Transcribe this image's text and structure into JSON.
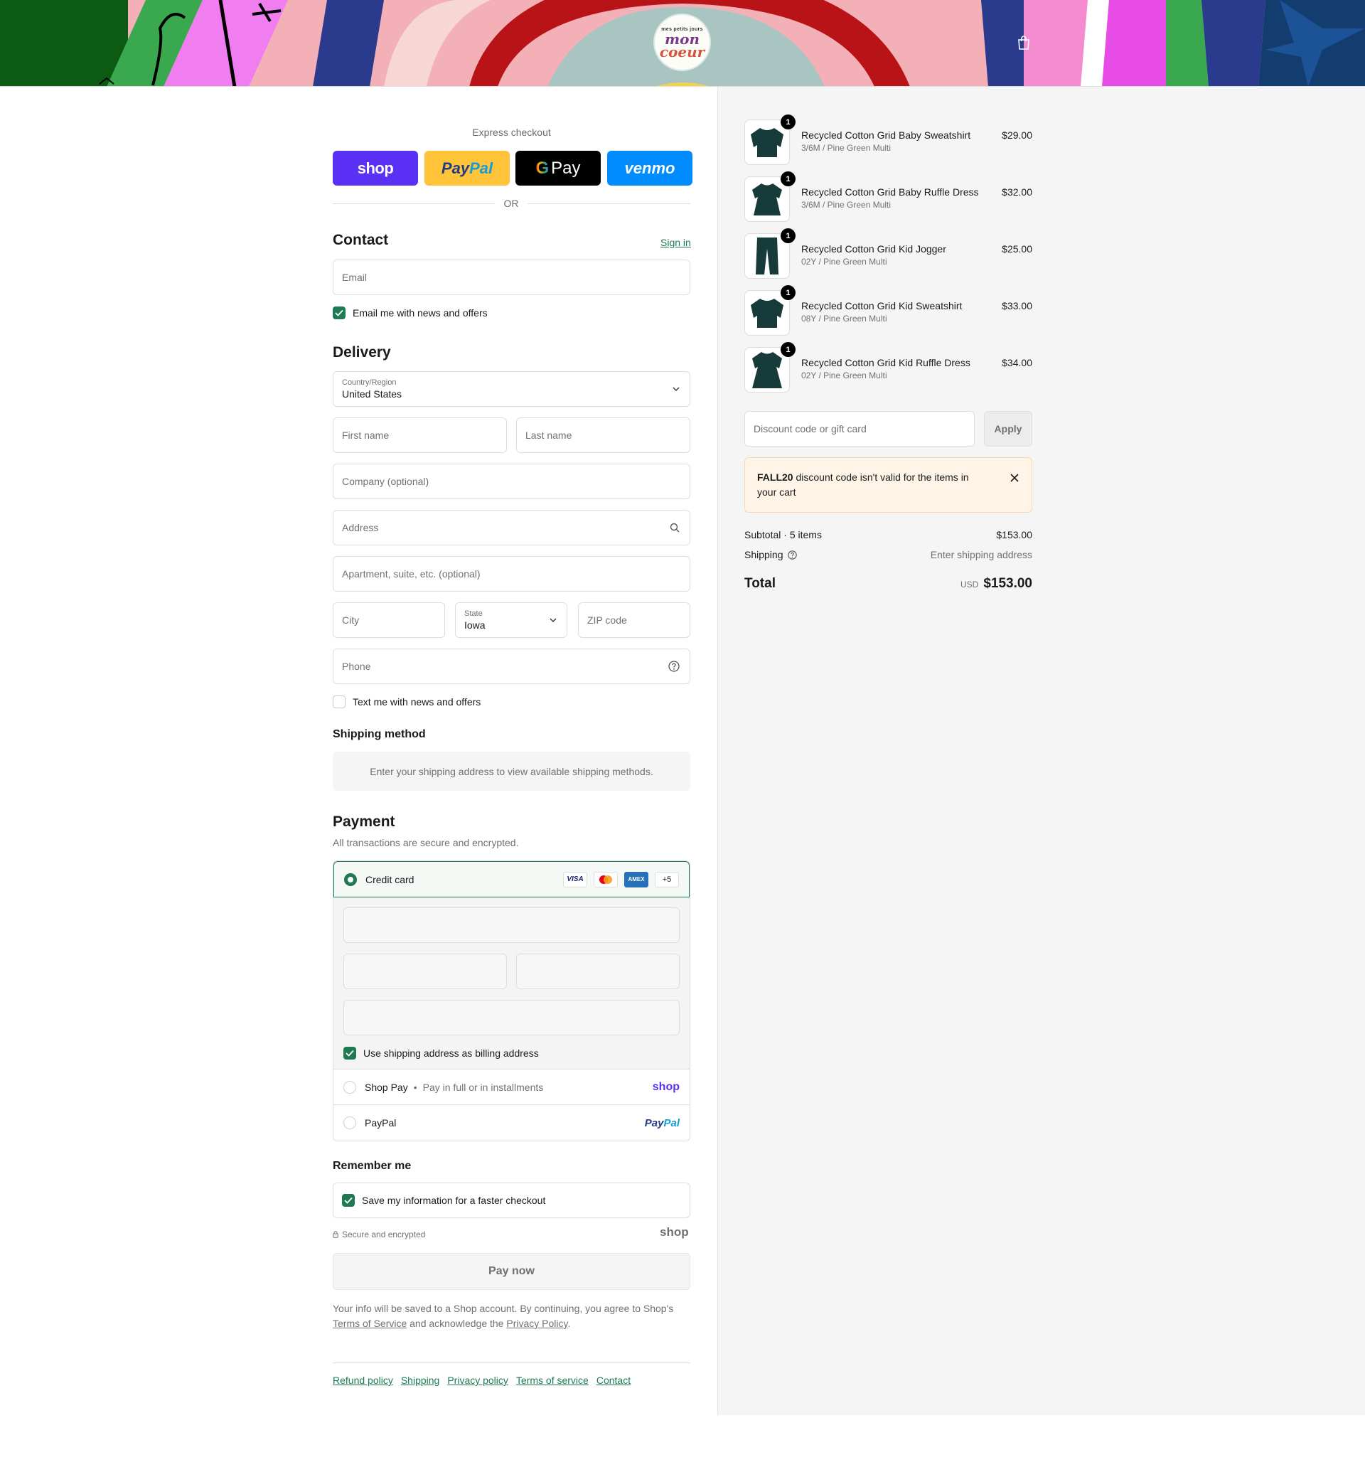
{
  "header": {
    "logo_small": "mes petits jours",
    "logo_line1": "mon",
    "logo_line2": "coeur"
  },
  "express": {
    "label": "Express checkout",
    "shop": "shop",
    "paypal_a": "Pay",
    "paypal_b": "Pal",
    "gpay_g": "G",
    "gpay_pay": "Pay",
    "venmo": "venmo",
    "or": "OR"
  },
  "contact": {
    "title": "Contact",
    "sign_in": "Sign in",
    "email_placeholder": "Email",
    "news_label": "Email me with news and offers"
  },
  "delivery": {
    "title": "Delivery",
    "country_label": "Country/Region",
    "country_value": "United States",
    "first_name": "First name",
    "last_name": "Last name",
    "company": "Company (optional)",
    "address": "Address",
    "apartment": "Apartment, suite, etc. (optional)",
    "city": "City",
    "state_label": "State",
    "state_value": "Iowa",
    "zip": "ZIP code",
    "phone": "Phone",
    "sms_label": "Text me with news and offers"
  },
  "shipping_method": {
    "title": "Shipping method",
    "notice": "Enter your shipping address to view available shipping methods."
  },
  "payment": {
    "title": "Payment",
    "subtitle": "All transactions are secure and encrypted.",
    "credit_card": "Credit card",
    "visa": "VISA",
    "amex": "AMEX",
    "more": "+5",
    "billing_label": "Use shipping address as billing address",
    "shoppay_label": "Shop Pay",
    "shoppay_sub": "Pay in full or in installments",
    "shoppay_logo": "shop",
    "paypal_label": "PayPal",
    "paypal_logo_a": "Pay",
    "paypal_logo_b": "Pal"
  },
  "remember": {
    "title": "Remember me",
    "save_label": "Save my information for a faster checkout",
    "secure": "Secure and encrypted",
    "shop_logo": "shop"
  },
  "paynow": "Pay now",
  "legal": {
    "text1": "Your info will be saved to a Shop account. By continuing, you agree to Shop's",
    "tos": "Terms of Service",
    "text2": "and acknowledge the",
    "privacy": "Privacy Policy",
    "text3": "."
  },
  "footer": {
    "links": [
      "Refund policy",
      "Shipping",
      "Privacy policy",
      "Terms of service",
      "Contact"
    ]
  },
  "cart": {
    "items": [
      {
        "name": "Recycled Cotton Grid Baby Sweatshirt",
        "variant": "3/6M / Pine Green Multi",
        "price": "$29.00",
        "qty": "1"
      },
      {
        "name": "Recycled Cotton Grid Baby Ruffle Dress",
        "variant": "3/6M / Pine Green Multi",
        "price": "$32.00",
        "qty": "1"
      },
      {
        "name": "Recycled Cotton Grid Kid Jogger",
        "variant": "02Y / Pine Green Multi",
        "price": "$25.00",
        "qty": "1"
      },
      {
        "name": "Recycled Cotton Grid Kid Sweatshirt",
        "variant": "08Y / Pine Green Multi",
        "price": "$33.00",
        "qty": "1"
      },
      {
        "name": "Recycled Cotton Grid Kid Ruffle Dress",
        "variant": "02Y / Pine Green Multi",
        "price": "$34.00",
        "qty": "1"
      }
    ],
    "discount_placeholder": "Discount code or gift card",
    "apply": "Apply",
    "alert_code": "FALL20",
    "alert_text": "discount code isn't valid for the items in your cart",
    "subtotal_label": "Subtotal · 5 items",
    "subtotal_value": "$153.00",
    "shipping_label": "Shipping",
    "shipping_value": "Enter shipping address",
    "total_label": "Total",
    "currency": "USD",
    "total_value": "$153.00"
  },
  "colors": {
    "accent": "#1f7a54",
    "shop_purple": "#5a31f4",
    "paypal_yellow": "#ffc439",
    "venmo_blue": "#008cff"
  }
}
